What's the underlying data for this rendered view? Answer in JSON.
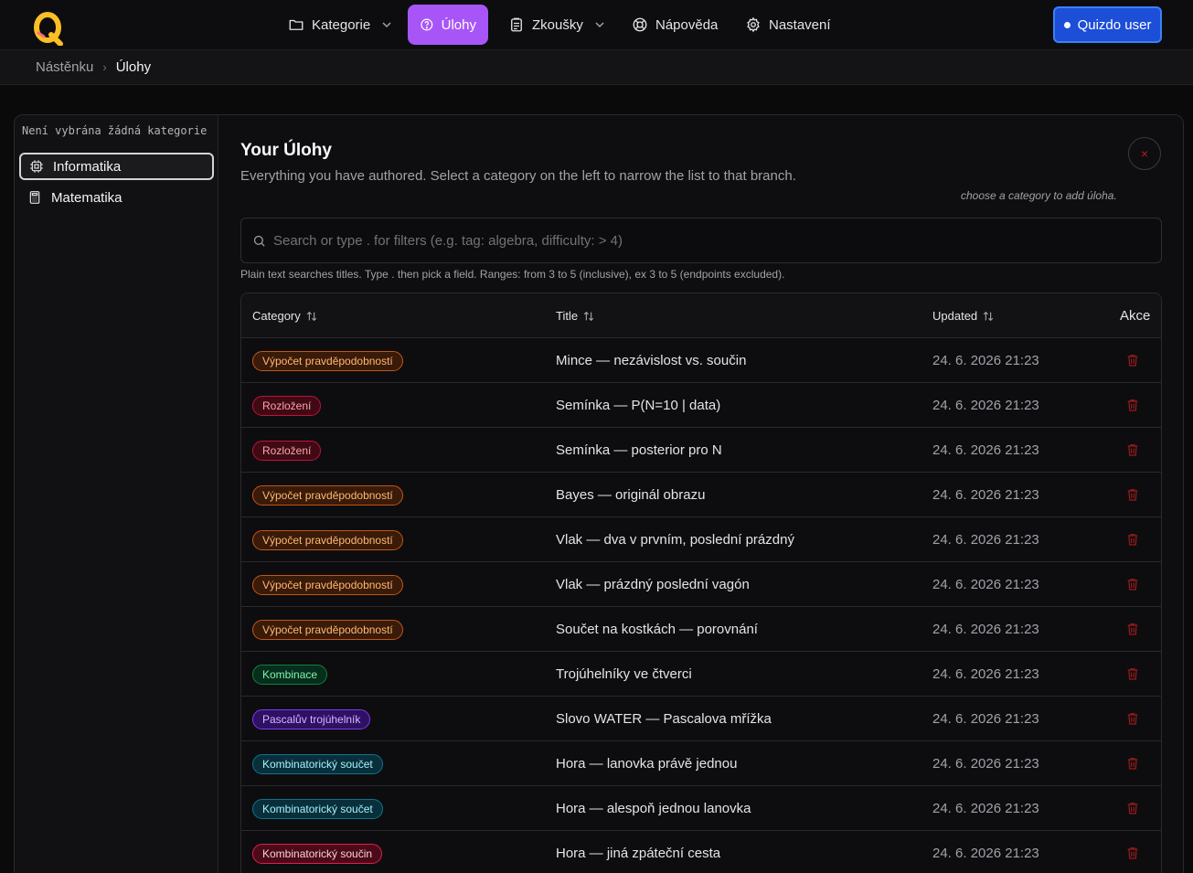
{
  "nav": {
    "items": [
      {
        "label": "Kategorie",
        "icon": "folder-icon",
        "dropdown": true,
        "active": false
      },
      {
        "label": "Úlohy",
        "icon": "help-circle-icon",
        "dropdown": false,
        "active": true
      },
      {
        "label": "Zkoušky",
        "icon": "clipboard-icon",
        "dropdown": true,
        "active": false
      },
      {
        "label": "Nápověda",
        "icon": "lifebuoy-icon",
        "dropdown": false,
        "active": false
      },
      {
        "label": "Nastavení",
        "icon": "gear-icon",
        "dropdown": false,
        "active": false
      }
    ],
    "user_label": "Quizdo user",
    "accent": "#a855f7",
    "user_color": "#1d4ed8"
  },
  "breadcrumb": {
    "parent": "Nástěnku",
    "current": "Úlohy"
  },
  "sidebar": {
    "title": "Není vybrána žádná kategorie",
    "items": [
      {
        "label": "Informatika",
        "icon": "cpu-icon",
        "selected": true
      },
      {
        "label": "Matematika",
        "icon": "calculator-icon",
        "selected": false
      }
    ]
  },
  "main": {
    "title": "Your Úlohy",
    "subtitle": "Everything you have authored. Select a category on the left to narrow the list to that branch.",
    "hint": "choose a category to add úloha.",
    "close_label": "×",
    "search_placeholder": "Search or type . for filters (e.g. tag: algebra, difficulty: > 4)",
    "search_value": "",
    "search_help": "Plain text searches titles. Type . then pick a field. Ranges: from 3 to 5 (inclusive), ex 3 to 5 (endpoints excluded)."
  },
  "table": {
    "headers": {
      "category": "Category",
      "title": "Title",
      "updated": "Updated",
      "actions": "Akce"
    },
    "rows": [
      {
        "category": "Výpočet pravděpodobností",
        "tone": "orange",
        "title": "Mince — nezávislost vs. součin",
        "updated": "24. 6. 2026 21:23"
      },
      {
        "category": "Rozložení",
        "tone": "red",
        "title": "Semínka — P(N=10 | data)",
        "updated": "24. 6. 2026 21:23"
      },
      {
        "category": "Rozložení",
        "tone": "red",
        "title": "Semínka — posterior pro N",
        "updated": "24. 6. 2026 21:23"
      },
      {
        "category": "Výpočet pravděpodobností",
        "tone": "orange",
        "title": "Bayes — originál obrazu",
        "updated": "24. 6. 2026 21:23"
      },
      {
        "category": "Výpočet pravděpodobností",
        "tone": "orange",
        "title": "Vlak — dva v prvním, poslední prázdný",
        "updated": "24. 6. 2026 21:23"
      },
      {
        "category": "Výpočet pravděpodobností",
        "tone": "orange",
        "title": "Vlak — prázdný poslední vagón",
        "updated": "24. 6. 2026 21:23"
      },
      {
        "category": "Výpočet pravděpodobností",
        "tone": "orange",
        "title": "Součet na kostkách — porovnání",
        "updated": "24. 6. 2026 21:23"
      },
      {
        "category": "Kombinace",
        "tone": "green",
        "title": "Trojúhelníky ve čtverci",
        "updated": "24. 6. 2026 21:23"
      },
      {
        "category": "Pascalův trojúhelník",
        "tone": "purple",
        "title": "Slovo WATER — Pascalova mřížka",
        "updated": "24. 6. 2026 21:23"
      },
      {
        "category": "Kombinatorický součet",
        "tone": "cyan",
        "title": "Hora — lanovka právě jednou",
        "updated": "24. 6. 2026 21:23"
      },
      {
        "category": "Kombinatorický součet",
        "tone": "cyan",
        "title": "Hora — alespoň jednou lanovka",
        "updated": "24. 6. 2026 21:23"
      },
      {
        "category": "Kombinatorický součin",
        "tone": "rose",
        "title": "Hora — jiná zpáteční cesta",
        "updated": "24. 6. 2026 21:23"
      }
    ],
    "tones": {
      "orange": {
        "bg": "#3a1a08",
        "border": "#c2571a",
        "text": "#fdba74"
      },
      "red": {
        "bg": "#3f0a14",
        "border": "#be123c",
        "text": "#fda4af"
      },
      "green": {
        "bg": "#052e1c",
        "border": "#15803d",
        "text": "#86efac"
      },
      "purple": {
        "bg": "#2e1065",
        "border": "#7c3aed",
        "text": "#d8b4fe"
      },
      "cyan": {
        "bg": "#082f3a",
        "border": "#0e7490",
        "text": "#a5f3fc"
      },
      "rose": {
        "bg": "#4a0a1a",
        "border": "#e11d48",
        "text": "#fecdd3"
      }
    },
    "delete_color": "#991b1b"
  }
}
